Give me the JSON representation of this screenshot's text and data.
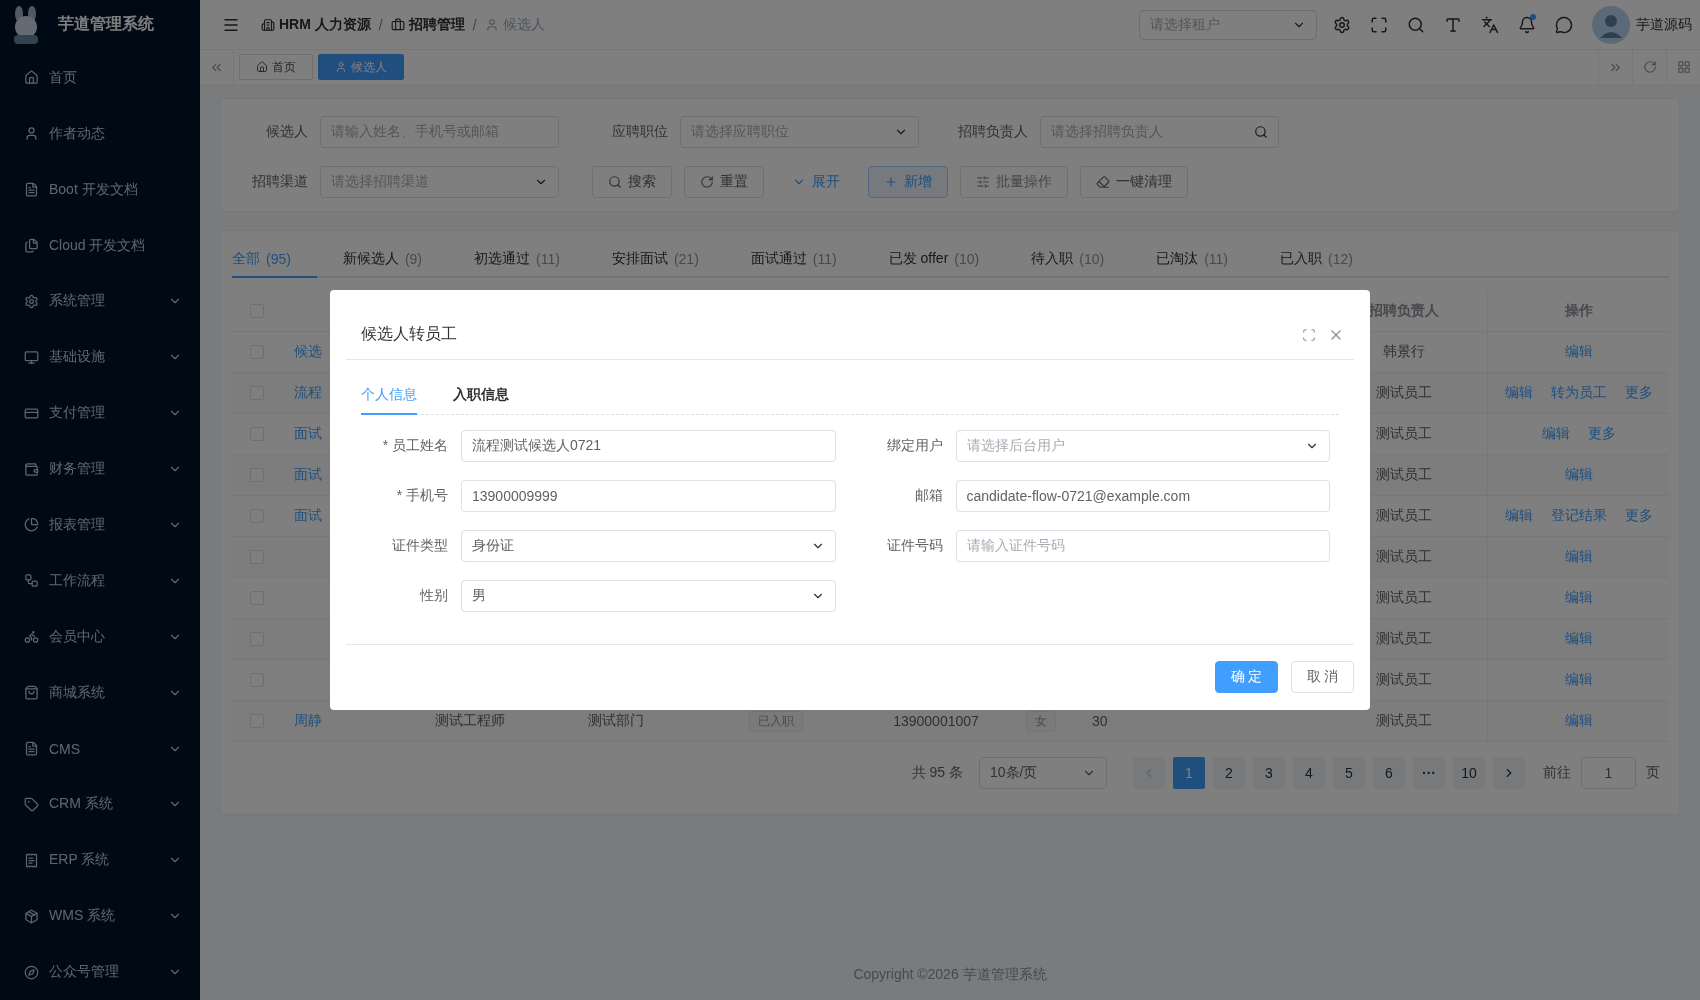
{
  "sidebar": {
    "title": "芋道管理系统",
    "items": [
      {
        "label": "首页",
        "expandable": false
      },
      {
        "label": "作者动态",
        "expandable": false
      },
      {
        "label": "Boot 开发文档",
        "expandable": false
      },
      {
        "label": "Cloud 开发文档",
        "expandable": false
      },
      {
        "label": "系统管理",
        "expandable": true
      },
      {
        "label": "基础设施",
        "expandable": true
      },
      {
        "label": "支付管理",
        "expandable": true
      },
      {
        "label": "财务管理",
        "expandable": true
      },
      {
        "label": "报表管理",
        "expandable": true
      },
      {
        "label": "工作流程",
        "expandable": true
      },
      {
        "label": "会员中心",
        "expandable": true
      },
      {
        "label": "商城系统",
        "expandable": true
      },
      {
        "label": "CMS",
        "expandable": true
      },
      {
        "label": "CRM 系统",
        "expandable": true
      },
      {
        "label": "ERP 系统",
        "expandable": true
      },
      {
        "label": "WMS 系统",
        "expandable": true
      },
      {
        "label": "公众号管理",
        "expandable": true
      }
    ]
  },
  "header": {
    "breadcrumb_separator": "/",
    "breadcrumb": [
      {
        "label": "HRM 人力资源",
        "current": false
      },
      {
        "label": "招聘管理",
        "current": false
      },
      {
        "label": "候选人",
        "current": true
      }
    ],
    "tenant_select": {
      "placeholder": "请选择租户"
    },
    "user": {
      "name": "芋道源码"
    }
  },
  "tags": [
    {
      "label": "首页",
      "selected": false
    },
    {
      "label": "候选人",
      "selected": true
    }
  ],
  "search_form": {
    "fields": [
      {
        "label": "候选人",
        "kind": "input",
        "placeholder": "请输入姓名、手机号或邮箱"
      },
      {
        "label": "应聘职位",
        "kind": "select",
        "placeholder": "请选择应聘职位"
      },
      {
        "label": "招聘负责人",
        "kind": "search",
        "placeholder": "请选择招聘负责人"
      },
      {
        "label": "招聘渠道",
        "kind": "select",
        "placeholder": "请选择招聘渠道"
      }
    ],
    "buttons": [
      {
        "label": "搜索",
        "kind": "search",
        "disabled": false
      },
      {
        "label": "重置",
        "kind": "reset",
        "disabled": false
      },
      {
        "label": "展开",
        "kind": "expand",
        "disabled": false
      },
      {
        "label": "新增",
        "kind": "add",
        "disabled": false
      },
      {
        "label": "批量操作",
        "kind": "batch",
        "disabled": true
      },
      {
        "label": "一键清理",
        "kind": "clean",
        "disabled": false
      }
    ]
  },
  "status_tabs": [
    {
      "label": "全部",
      "count": "(95)",
      "selected": true
    },
    {
      "label": "新候选人",
      "count": "(9)",
      "selected": false
    },
    {
      "label": "初选通过",
      "count": "(11)",
      "selected": false
    },
    {
      "label": "安排面试",
      "count": "(21)",
      "selected": false
    },
    {
      "label": "面试通过",
      "count": "(11)",
      "selected": false
    },
    {
      "label": "已发 offer",
      "count": "(10)",
      "selected": false
    },
    {
      "label": "待入职",
      "count": "(10)",
      "selected": false
    },
    {
      "label": "已淘汰",
      "count": "(11)",
      "selected": false
    },
    {
      "label": "已入职",
      "count": "(12)",
      "selected": false
    }
  ],
  "table": {
    "header": {
      "checked": false,
      "recruiter": "招聘负责人",
      "actions": "操作"
    },
    "rows": [
      {
        "checked": false,
        "name": "候选",
        "recruiter": "韩景行",
        "actions": [
          "编辑"
        ]
      },
      {
        "checked": false,
        "name": "流程",
        "recruiter": "测试员工",
        "actions": [
          "编辑",
          "转为员工",
          "更多"
        ]
      },
      {
        "checked": false,
        "name": "面试",
        "recruiter": "测试员工",
        "actions": [
          "编辑",
          "更多"
        ]
      },
      {
        "checked": false,
        "name": "面试",
        "recruiter": "测试员工",
        "actions": [
          "编辑"
        ]
      },
      {
        "checked": false,
        "name": "面试",
        "recruiter": "测试员工",
        "actions": [
          "编辑",
          "登记结果",
          "更多"
        ]
      },
      {
        "checked": false,
        "recruiter": "测试员工",
        "actions": [
          "编辑"
        ]
      },
      {
        "checked": false,
        "recruiter": "测试员工",
        "actions": [
          "编辑"
        ]
      },
      {
        "checked": false,
        "recruiter": "测试员工",
        "actions": [
          "编辑"
        ]
      },
      {
        "checked": false,
        "recruiter": "测试员工",
        "actions": [
          "编辑"
        ]
      },
      {
        "checked": false,
        "name": "周静",
        "position": "测试工程师",
        "department": "测试部门",
        "status": "已入职",
        "phone": "13900001007",
        "gender": "女",
        "age": "30",
        "recruiter": "测试员工",
        "actions": [
          "编辑"
        ]
      }
    ]
  },
  "pagination": {
    "total": "共 95 条",
    "page_size": "10条/页",
    "pages": [
      {
        "label": "1",
        "selected": true
      },
      {
        "label": "2",
        "selected": false
      },
      {
        "label": "3",
        "selected": false
      },
      {
        "label": "4",
        "selected": false
      },
      {
        "label": "5",
        "selected": false
      },
      {
        "label": "6",
        "selected": false
      },
      {
        "label": "···",
        "selected": false
      },
      {
        "label": "10",
        "selected": false
      }
    ],
    "goto_label": "前往",
    "goto_value": "1",
    "goto_suffix": "页"
  },
  "footer": "Copyright ©2026 芋道管理系统",
  "dialog": {
    "title": "候选人转员工",
    "tabs": [
      {
        "label": "个人信息",
        "selected": true
      },
      {
        "label": "入职信息",
        "selected": false
      }
    ],
    "fields": [
      {
        "label": "* 员工姓名",
        "kind": "input",
        "value": "流程测试候选人0721"
      },
      {
        "label": "绑定用户",
        "kind": "select",
        "placeholder": "请选择后台用户"
      },
      {
        "label": "* 手机号",
        "kind": "input",
        "value": "13900009999"
      },
      {
        "label": "邮箱",
        "kind": "input",
        "value": "candidate-flow-0721@example.com"
      },
      {
        "label": "证件类型",
        "kind": "select",
        "value": "身份证"
      },
      {
        "label": "证件号码",
        "kind": "input",
        "placeholder": "请输入证件号码"
      },
      {
        "label": "性别",
        "kind": "select",
        "value": "男"
      }
    ],
    "buttons": [
      {
        "label": "确 定",
        "kind": "primary"
      },
      {
        "label": "取 消",
        "kind": "default"
      }
    ]
  }
}
